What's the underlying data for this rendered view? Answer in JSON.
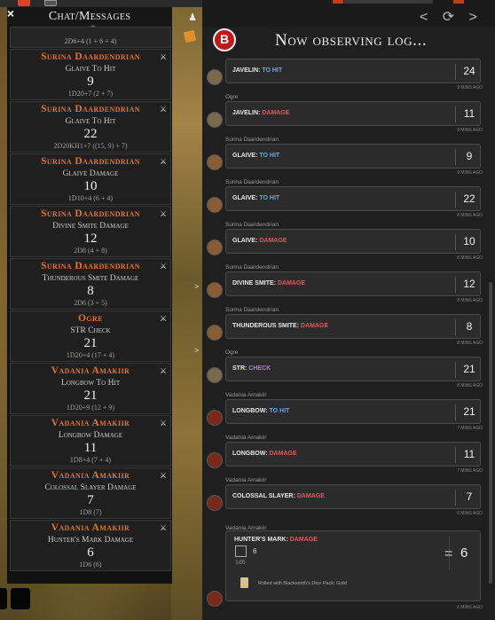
{
  "chat": {
    "title": "Chat/Messages",
    "close": "×",
    "partial_formula": "2D6+4 (1 + 6 + 4)",
    "messages": [
      {
        "name": "Surina Daardendrian",
        "roll": "Glaive To Hit",
        "total": "9",
        "formula": "1D20+7 (2 + 7)"
      },
      {
        "name": "Surina Daardendrian",
        "roll": "Glaive To Hit",
        "total": "22",
        "formula": "2D20KH1+7 ((15, 9) + 7)"
      },
      {
        "name": "Surina Daardendrian",
        "roll": "Glaive Damage",
        "total": "10",
        "formula": "1D10+4 (6 + 4)"
      },
      {
        "name": "Surina Daardendrian",
        "roll": "Divine Smite Damage",
        "total": "12",
        "formula": "2D8 (4 + 8)"
      },
      {
        "name": "Surina Daardendrian",
        "roll": "Thunderous Smite Damage",
        "total": "8",
        "formula": "2D6 (3 + 5)"
      },
      {
        "name": "Ogre",
        "roll": "STR Check",
        "total": "21",
        "formula": "1D20+4 (17 + 4)"
      },
      {
        "name": "Vadania Amakiir",
        "roll": "Longbow To Hit",
        "total": "21",
        "formula": "1D20+9 (12 + 9)"
      },
      {
        "name": "Vadania Amakiir",
        "roll": "Longbow Damage",
        "total": "11",
        "formula": "1D8+4 (7 + 4)"
      },
      {
        "name": "Vadania Amakiir",
        "roll": "Colossal Slayer Damage",
        "total": "7",
        "formula": "1D8 (7)"
      },
      {
        "name": "Vadania Amakiir",
        "roll": "Hunter's Mark Damage",
        "total": "6",
        "formula": "1D6 (6)"
      }
    ]
  },
  "log": {
    "title": "Now observing log...",
    "nav_icons": "< ⟳ >",
    "entries": [
      {
        "who": "",
        "action": "JAVELIN:",
        "kind": "TO HIT",
        "kind_class": "hit",
        "total": "24",
        "ago": "9 MINS AGO",
        "avatar": "ogre"
      },
      {
        "who": "Ogre",
        "action": "JAVELIN:",
        "kind": "DAMAGE",
        "kind_class": "dmg",
        "total": "11",
        "ago": "9 MINS AGO",
        "avatar": "ogre"
      },
      {
        "who": "Surina Daardendrian",
        "action": "GLAIVE:",
        "kind": "TO HIT",
        "kind_class": "hit",
        "total": "9",
        "ago": "9 MINS AGO",
        "avatar": "sur"
      },
      {
        "who": "Surina Daardendrian",
        "action": "GLAIVE:",
        "kind": "TO HIT",
        "kind_class": "hit",
        "total": "22",
        "ago": "8 MINS AGO",
        "avatar": "sur"
      },
      {
        "who": "Surina Daardendrian",
        "action": "GLAIVE:",
        "kind": "DAMAGE",
        "kind_class": "dmg",
        "total": "10",
        "ago": "8 MINS AGO",
        "avatar": "sur"
      },
      {
        "who": "Surina Daardendrian",
        "action": "DIVINE SMITE:",
        "kind": "DAMAGE",
        "kind_class": "dmg",
        "total": "12",
        "ago": "8 MINS AGO",
        "avatar": "sur"
      },
      {
        "who": "Surina Daardendrian",
        "action": "THUNDEROUS SMITE:",
        "kind": "DAMAGE",
        "kind_class": "dmg",
        "total": "8",
        "ago": "8 MINS AGO",
        "avatar": "sur"
      },
      {
        "who": "Ogre",
        "action": "STR:",
        "kind": "CHECK",
        "kind_class": "chk",
        "total": "21",
        "ago": "8 MINS AGO",
        "avatar": "ogre"
      },
      {
        "who": "Vadania Amakiir",
        "action": "LONGBOW:",
        "kind": "TO HIT",
        "kind_class": "hit",
        "total": "21",
        "ago": "7 MINS AGO",
        "avatar": "vad"
      },
      {
        "who": "Vadania Amakiir",
        "action": "LONGBOW:",
        "kind": "DAMAGE",
        "kind_class": "dmg",
        "total": "11",
        "ago": "7 MINS AGO",
        "avatar": "vad"
      },
      {
        "who": "Vadania Amakiir",
        "action": "COLOSSAL SLAYER:",
        "kind": "DAMAGE",
        "kind_class": "dmg",
        "total": "7",
        "ago": "6 MINS AGO",
        "avatar": "vad"
      }
    ],
    "last": {
      "who": "Vadania Amakiir",
      "action": "HUNTER'S MARK:",
      "kind": "DAMAGE",
      "die_value": "6",
      "formula": "1d6",
      "equals": "=",
      "total": "6",
      "pack": "Rolled with Blacksmith's Dice Pack: Gold",
      "ago": "6 MINS AGO"
    }
  },
  "colors": {
    "name_orange": "#e8742a",
    "to_hit": "#6fa6e8",
    "damage": "#e05a5a",
    "check": "#b27de0"
  }
}
